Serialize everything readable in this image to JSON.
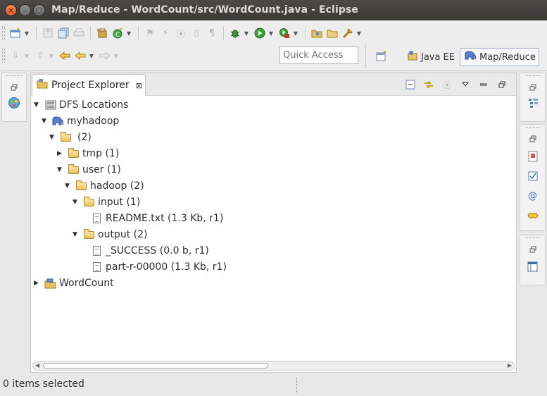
{
  "window": {
    "title": "Map/Reduce - WordCount/src/WordCount.java - Eclipse",
    "buttons": {
      "close": "×",
      "minimize": "–",
      "maximize": "□"
    }
  },
  "toolbar": {
    "quick_access_placeholder": "Quick Access"
  },
  "perspectives": [
    {
      "label": "Java EE",
      "active": false
    },
    {
      "label": "Map/Reduce",
      "active": true
    }
  ],
  "view": {
    "tab_title": "Project Explorer",
    "tab_close": "⊠"
  },
  "tree": [
    {
      "label": "DFS Locations",
      "level": 0,
      "expanded": true,
      "icon": "dfs-locations-icon"
    },
    {
      "label": "myhadoop",
      "level": 1,
      "expanded": true,
      "icon": "elephant-icon"
    },
    {
      "label": "(2)",
      "level": 2,
      "expanded": true,
      "icon": "folder-icon"
    },
    {
      "label": "tmp (1)",
      "level": 3,
      "expanded": false,
      "icon": "folder-icon"
    },
    {
      "label": "user (1)",
      "level": 3,
      "expanded": true,
      "icon": "folder-icon"
    },
    {
      "label": "hadoop (2)",
      "level": 4,
      "expanded": true,
      "icon": "folder-icon"
    },
    {
      "label": "input (1)",
      "level": 5,
      "expanded": true,
      "icon": "folder-icon"
    },
    {
      "label": "README.txt (1.3 Kb, r1)",
      "level": 6,
      "expanded": null,
      "icon": "file-icon"
    },
    {
      "label": "output (2)",
      "level": 5,
      "expanded": true,
      "icon": "folder-icon"
    },
    {
      "label": "_SUCCESS (0.0 b, r1)",
      "level": 6,
      "expanded": null,
      "icon": "file-icon"
    },
    {
      "label": "part-r-00000 (1.3 Kb, r1)",
      "level": 6,
      "expanded": null,
      "icon": "file-icon"
    },
    {
      "label": "WordCount",
      "level": 0,
      "expanded": false,
      "icon": "project-icon"
    }
  ],
  "status": {
    "text": "0 items selected"
  },
  "colors": {
    "titlebar": "#3b3a36",
    "close_button": "#e05a26",
    "active_perspective_border": "#a9b9cc"
  }
}
